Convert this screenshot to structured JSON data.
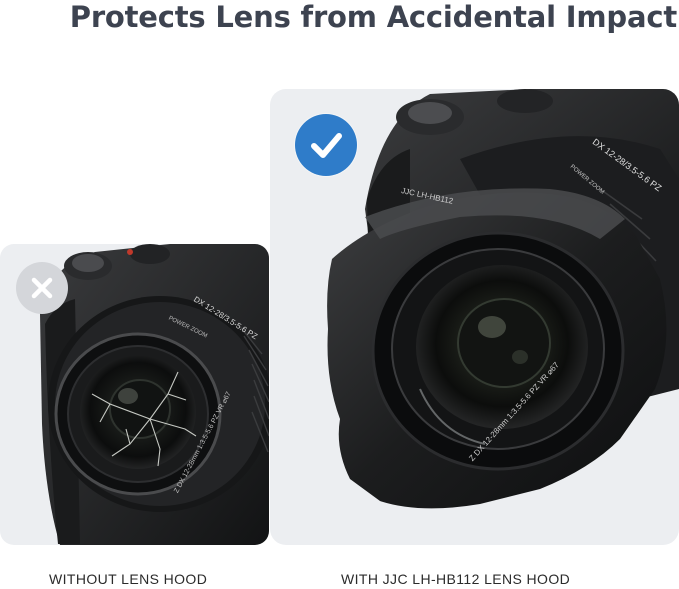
{
  "headline": "Protects Lens from Accidental Impact",
  "panels": [
    {
      "caption": "WITHOUT LENS HOOD",
      "status_icon": "x-icon",
      "badge_color": "#d4d6da",
      "lens_barrel_text": "DX 12-28/3.5-5.6 PZ",
      "lens_front_text": "Z DX 12-28mm 1:3.5-5.6 PZ VR  ⌀67",
      "zoom_label": "POWER ZOOM",
      "state": "cracked-lens"
    },
    {
      "caption": "WITH JJC LH-HB112 LENS HOOD",
      "status_icon": "check-icon",
      "badge_color": "#2f7cc9",
      "hood_text": "JJC LH-HB112",
      "lens_barrel_text": "DX 12-28/3.5-5.6 PZ",
      "lens_front_text": "Z DX 12-28mm 1:3.5-5.6 PZ VR  ⌀67",
      "zoom_label": "POWER ZOOM",
      "state": "protected-lens"
    }
  ]
}
